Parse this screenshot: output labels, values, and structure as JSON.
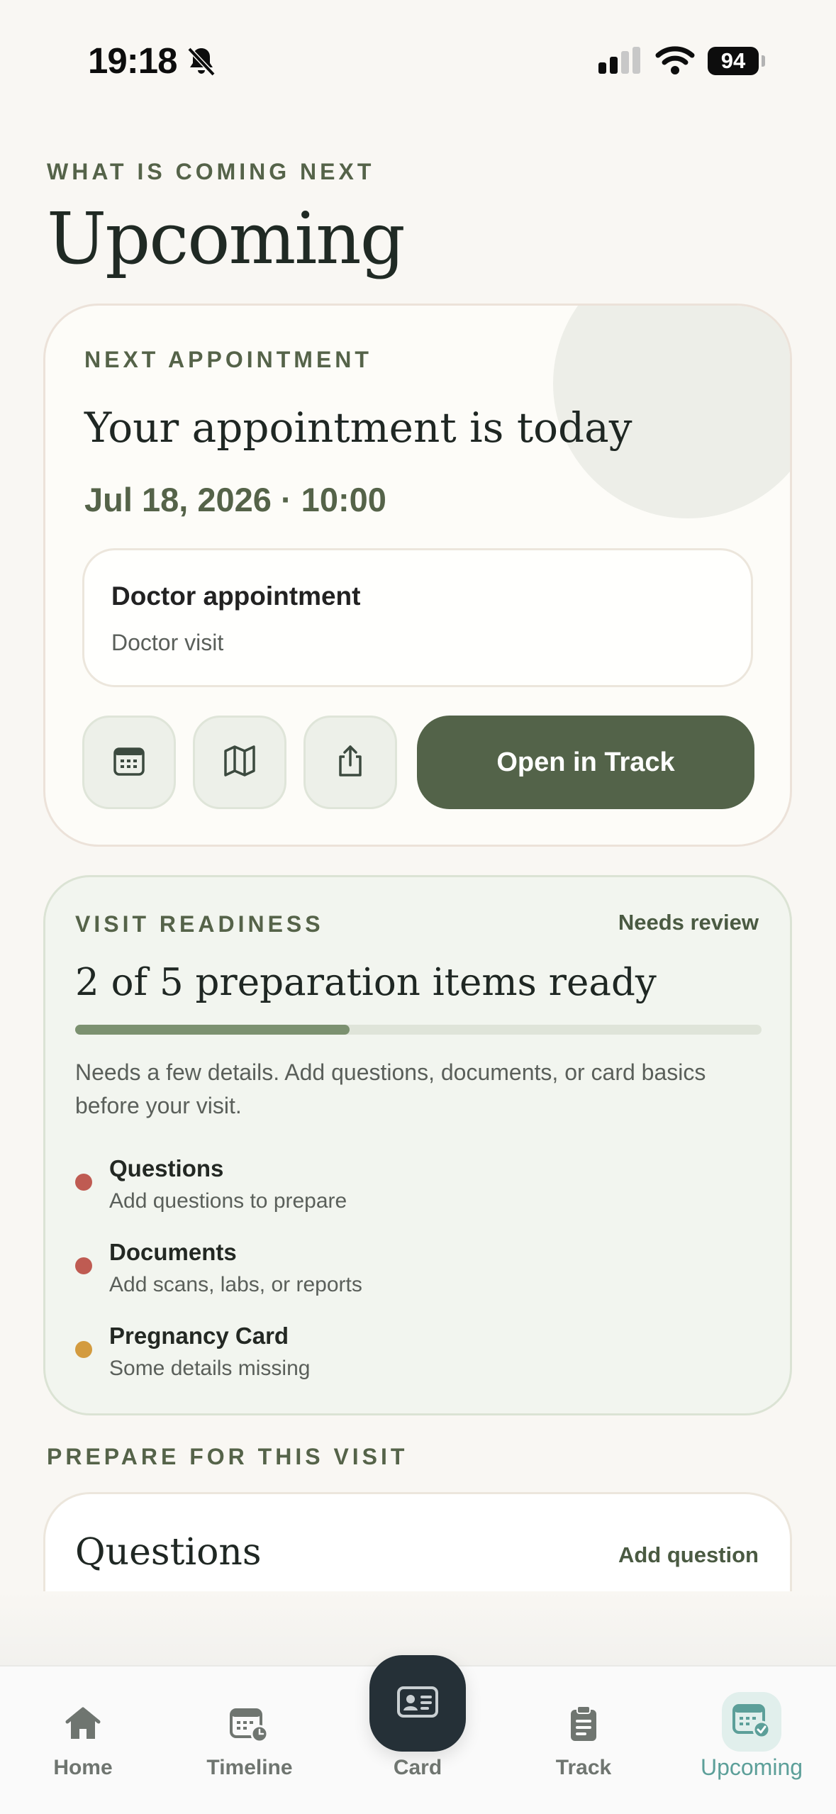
{
  "status_bar": {
    "time": "19:18",
    "battery": "94"
  },
  "header": {
    "eyebrow": "WHAT IS COMING NEXT",
    "title": "Upcoming"
  },
  "appointment": {
    "section_label": "NEXT APPOINTMENT",
    "title": "Your appointment is today",
    "datetime": "Jul 18, 2026 · 10:00",
    "detail_title": "Doctor appointment",
    "detail_subtitle": "Doctor visit",
    "actions": {
      "calendar_icon": "calendar-icon",
      "map_icon": "map-icon",
      "share_icon": "share-icon"
    },
    "open_button": "Open in Track"
  },
  "readiness": {
    "section_label": "VISIT READINESS",
    "status": "Needs review",
    "title": "2 of 5 preparation items ready",
    "progress": 0.4,
    "description": "Needs a few details. Add questions, documents, or card basics before your visit.",
    "items": [
      {
        "title": "Questions",
        "subtitle": "Add questions to prepare",
        "color": "#bf5b52"
      },
      {
        "title": "Documents",
        "subtitle": "Add scans, labs, or reports",
        "color": "#bf5b52"
      },
      {
        "title": "Pregnancy Card",
        "subtitle": "Some details missing",
        "color": "#d39b3f"
      }
    ]
  },
  "prepare": {
    "section_label": "PREPARE FOR THIS VISIT",
    "card_title": "Questions",
    "card_action": "Add question"
  },
  "tabs": [
    {
      "label": "Home",
      "icon": "home-icon"
    },
    {
      "label": "Timeline",
      "icon": "timeline-icon"
    },
    {
      "label": "Card",
      "icon": "id-card-icon"
    },
    {
      "label": "Track",
      "icon": "clipboard-icon"
    },
    {
      "label": "Upcoming",
      "icon": "calendar-check-icon",
      "active": true
    }
  ],
  "colors": {
    "accent": "#536349",
    "active_tab": "#5c9f99"
  }
}
